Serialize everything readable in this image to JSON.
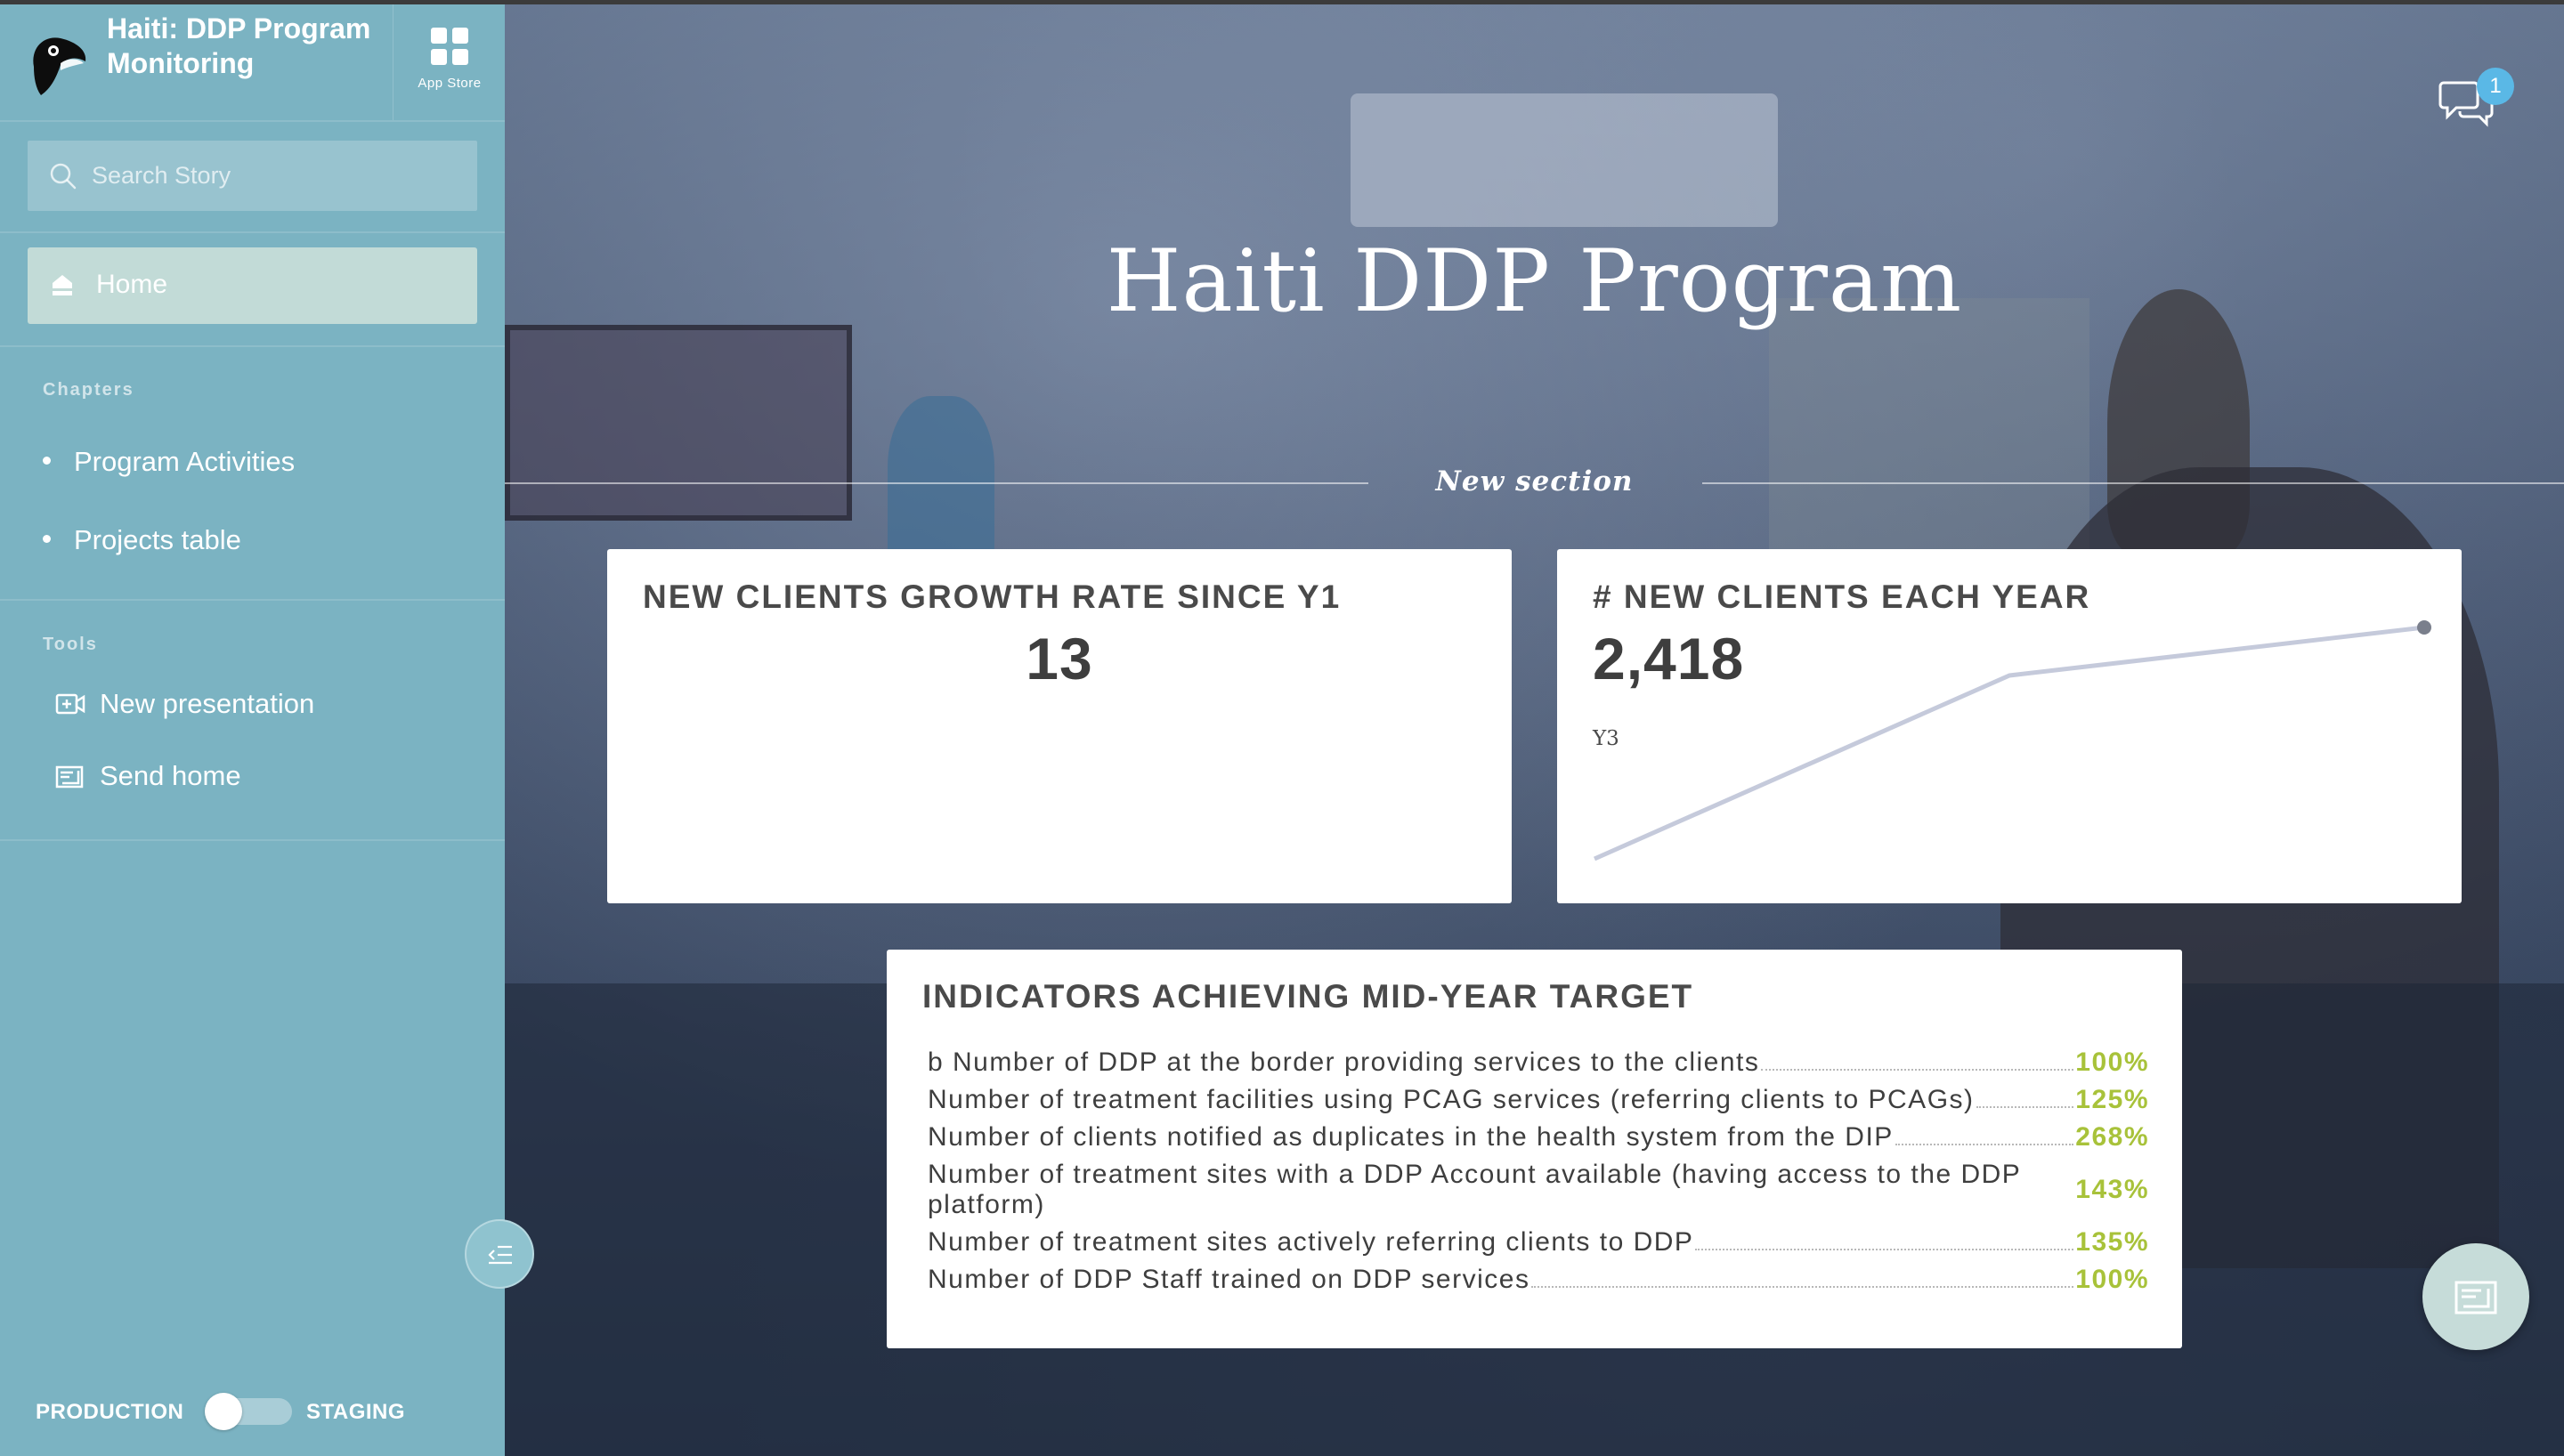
{
  "sidebar": {
    "brand_title": "Haiti: DDP Program Monitoring",
    "app_store_label": "App Store",
    "search_placeholder": "Search Story",
    "home_label": "Home",
    "chapters_label": "Chapters",
    "chapters": [
      {
        "label": "Program Activities"
      },
      {
        "label": "Projects table"
      }
    ],
    "tools_label": "Tools",
    "tools": [
      {
        "label": "New presentation",
        "icon": "video-add-icon"
      },
      {
        "label": "Send home",
        "icon": "send-home-icon"
      }
    ],
    "env_left": "PRODUCTION",
    "env_right": "STAGING"
  },
  "main": {
    "title": "Haiti DDP Program",
    "section_title": "New section",
    "chat_badge": "1"
  },
  "cards": {
    "growth": {
      "title": "NEW CLIENTS GROWTH RATE SINCE Y1",
      "value": "13"
    },
    "new_clients": {
      "title": "# NEW CLIENTS EACH YEAR",
      "value": "2,418",
      "x_label": "Y3"
    },
    "indicators": {
      "title": "INDICATORS ACHIEVING MID-YEAR TARGET",
      "rows": [
        {
          "label": "b Number of DDP at the border providing services to the clients",
          "value": "100%"
        },
        {
          "label": "Number of treatment facilities using PCAG services (referring clients to PCAGs)",
          "value": "125%"
        },
        {
          "label": "Number of clients notified as duplicates in the health system from the DIP",
          "value": "268%"
        },
        {
          "label": "Number of treatment sites with a DDP Account available (having access to the DDP platform)",
          "value": "143%"
        },
        {
          "label": "Number of treatment sites actively referring clients to DDP",
          "value": "135%"
        },
        {
          "label": "Number of DDP Staff trained on DDP services",
          "value": "100%"
        }
      ]
    }
  },
  "colors": {
    "sidebar_bg": "#7bb3c2",
    "home_active": "#c2dbd7",
    "indicator_value": "#a8c23a",
    "badge": "#5ab8e6",
    "sparkline": "#c5cadb"
  }
}
